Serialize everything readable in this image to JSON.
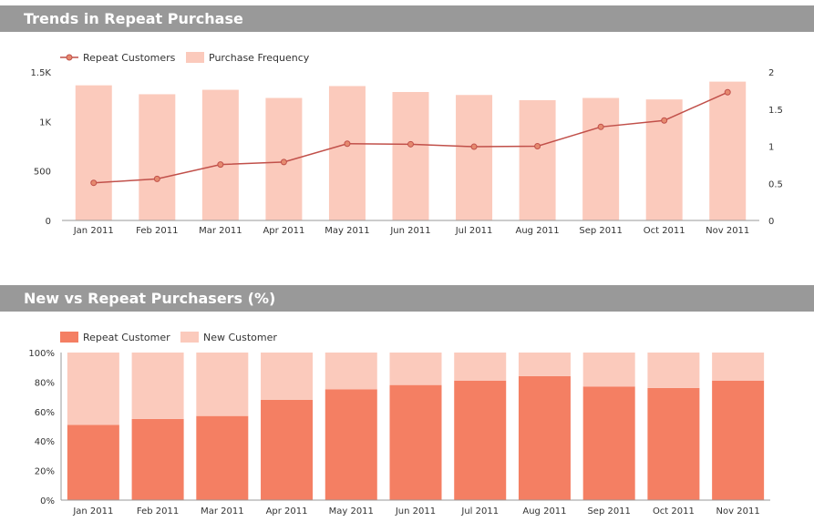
{
  "panels": {
    "top_title": "Trends in Repeat Purchase",
    "bottom_title": "New vs Repeat Purchasers (%)"
  },
  "chart_data": [
    {
      "type": "bar",
      "categories": [
        "Jan 2011",
        "Feb 2011",
        "Mar 2011",
        "Apr 2011",
        "May 2011",
        "Jun 2011",
        "Jul 2011",
        "Aug 2011",
        "Sep 2011",
        "Oct 2011",
        "Nov 2011"
      ],
      "series": [
        {
          "name": "Purchase Frequency",
          "type": "bar",
          "axis": "right",
          "values": [
            1.82,
            1.7,
            1.76,
            1.65,
            1.81,
            1.73,
            1.69,
            1.62,
            1.65,
            1.63,
            1.87
          ]
        },
        {
          "name": "Repeat Customers",
          "type": "line",
          "axis": "left",
          "values": [
            380,
            420,
            565,
            590,
            775,
            770,
            745,
            750,
            945,
            1010,
            1295
          ]
        }
      ],
      "y_left": {
        "ylim": [
          0,
          1500
        ],
        "ticks": [
          "0",
          "500",
          "1K",
          "1.5K"
        ],
        "tick_values": [
          0,
          500,
          1000,
          1500
        ]
      },
      "y_right": {
        "ylim": [
          0,
          2
        ],
        "ticks": [
          "0",
          "0.5",
          "1",
          "1.5",
          "2"
        ],
        "tick_values": [
          0,
          0.5,
          1,
          1.5,
          2
        ]
      },
      "legend": "top-left",
      "colors": {
        "bar": "#fbcabc",
        "line": "#c1504a"
      }
    },
    {
      "type": "bar",
      "stacked": true,
      "categories": [
        "Jan 2011",
        "Feb 2011",
        "Mar 2011",
        "Apr 2011",
        "May 2011",
        "Jun 2011",
        "Jul 2011",
        "Aug 2011",
        "Sep 2011",
        "Oct 2011",
        "Nov 2011"
      ],
      "series": [
        {
          "name": "Repeat Customer",
          "values": [
            51,
            55,
            57,
            68,
            75,
            78,
            81,
            84,
            77,
            76,
            81
          ]
        },
        {
          "name": "New Customer",
          "values": [
            49,
            45,
            43,
            32,
            25,
            22,
            19,
            16,
            23,
            24,
            19
          ]
        }
      ],
      "y": {
        "ylim": [
          0,
          100
        ],
        "ticks": [
          "0%",
          "20%",
          "40%",
          "60%",
          "80%",
          "100%"
        ],
        "tick_values": [
          0,
          20,
          40,
          60,
          80,
          100
        ]
      },
      "legend": "top-left",
      "colors": {
        "repeat": "#f47f63",
        "new": "#fbcabc"
      }
    }
  ]
}
